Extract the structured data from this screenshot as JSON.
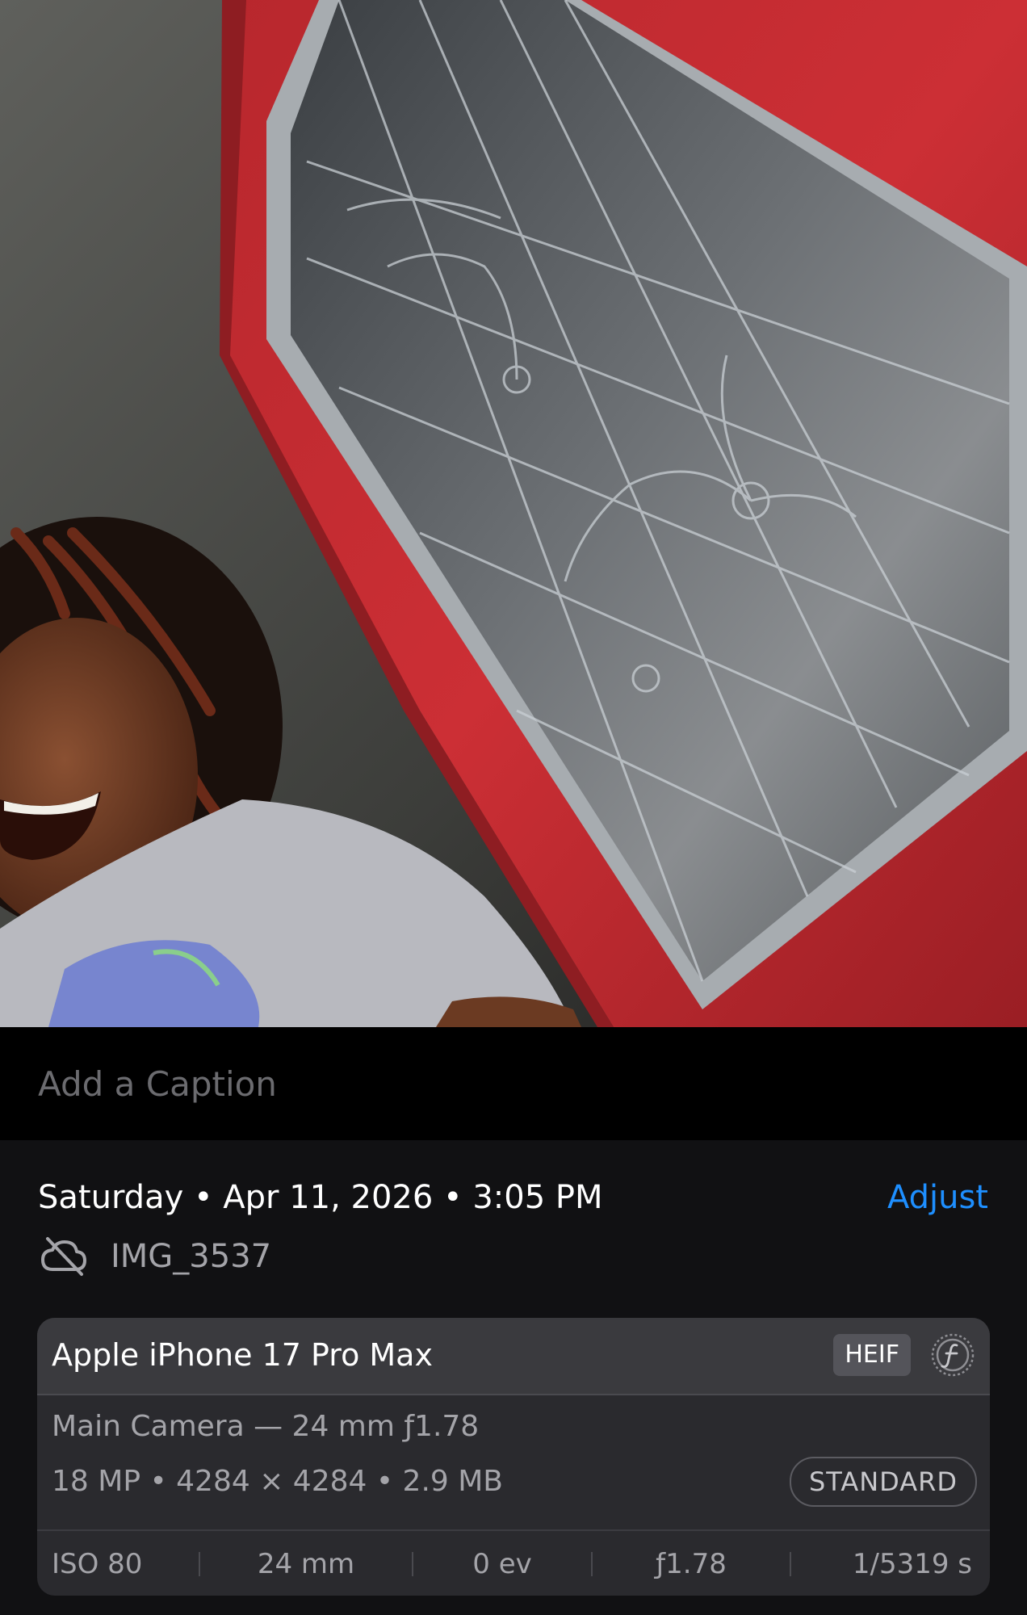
{
  "caption": {
    "placeholder": "Add a Caption",
    "value": ""
  },
  "info": {
    "date_line": "Saturday • Apr 11, 2026 • 3:05 PM",
    "adjust_label": "Adjust",
    "cloud_icon": "cloud-off-icon",
    "file_name": "IMG_3537"
  },
  "camera": {
    "device": "Apple iPhone 17 Pro Max",
    "format_badge": "HEIF",
    "format_icon": "f-stop-circle-icon",
    "lens": "Main Camera — 24 mm ƒ1.78",
    "specs": "18 MP • 4284 × 4284 • 2.9 MB",
    "profile": "STANDARD",
    "exif": {
      "iso": "ISO 80",
      "focal_length": "24 mm",
      "exposure_bias": "0 ev",
      "aperture": "ƒ1.78",
      "shutter": "1/5319 s"
    }
  },
  "colors": {
    "accent": "#1e8fff",
    "panel_bg": "#111113",
    "card_bg": "#2a2a2e",
    "card_header_bg": "#3a3a3e",
    "secondary_text": "#a4a4a9",
    "wall_red": "#c62d34"
  }
}
